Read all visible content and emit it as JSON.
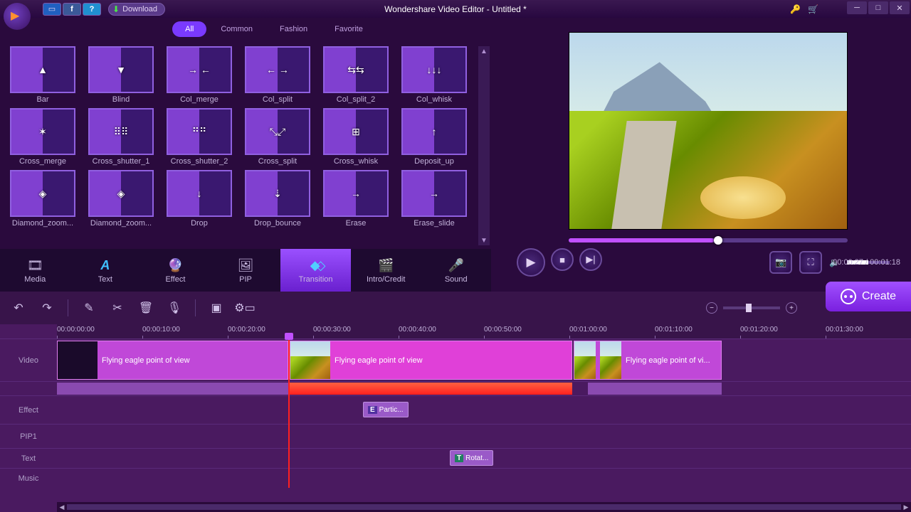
{
  "window": {
    "title": "Wondershare Video Editor - Untitled *",
    "download": "Download"
  },
  "filters": {
    "all": "All",
    "common": "Common",
    "fashion": "Fashion",
    "favorite": "Favorite",
    "active": "All"
  },
  "transitions": [
    {
      "name": "Bar",
      "g": "▲"
    },
    {
      "name": "Blind",
      "g": "▼"
    },
    {
      "name": "Col_merge",
      "g": "→ ←"
    },
    {
      "name": "Col_split",
      "g": "← →"
    },
    {
      "name": "Col_split_2",
      "g": "⇆⇆"
    },
    {
      "name": "Col_whisk",
      "g": "↓↓↓"
    },
    {
      "name": "Cross_merge",
      "g": "✶"
    },
    {
      "name": "Cross_shutter_1",
      "g": "⠿⠿"
    },
    {
      "name": "Cross_shutter_2",
      "g": "⠛⠛"
    },
    {
      "name": "Cross_split",
      "g": "⤡⤢"
    },
    {
      "name": "Cross_whisk",
      "g": "⊞"
    },
    {
      "name": "Deposit_up",
      "g": "↑"
    },
    {
      "name": "Diamond_zoom...",
      "g": "◈"
    },
    {
      "name": "Diamond_zoom...",
      "g": "◈"
    },
    {
      "name": "Drop",
      "g": "↓"
    },
    {
      "name": "Drop_bounce",
      "g": "⇣"
    },
    {
      "name": "Erase",
      "g": "→"
    },
    {
      "name": "Erase_slide",
      "g": "→"
    }
  ],
  "categories": {
    "media": "Media",
    "text": "Text",
    "effect": "Effect",
    "pip": "PIP",
    "transition": "Transition",
    "intro": "Intro/Credit",
    "sound": "Sound",
    "active": "transition"
  },
  "playback": {
    "time_current": "00:00:27",
    "time_total": "00:01:18"
  },
  "create_label": "Create",
  "ruler": [
    "00:00:00:00",
    "00:00:10:00",
    "00:00:20:00",
    "00:00:30:00",
    "00:00:40:00",
    "00:00:50:00",
    "00:01:00:00",
    "00:01:10:00",
    "00:01:20:00",
    "00:01:30:00"
  ],
  "tracks": {
    "video": "Video",
    "effect": "Effect",
    "pip1": "PIP1",
    "text": "Text",
    "music": "Music"
  },
  "clips": {
    "v1_label": "Flying eagle point of view",
    "v2_label": "Flying eagle point of view",
    "v3_label": "Flying eagle point of vi...",
    "fx_label": "Partic...",
    "fx_badge": "E",
    "txt_label": "Rotat...",
    "txt_badge": "T"
  }
}
